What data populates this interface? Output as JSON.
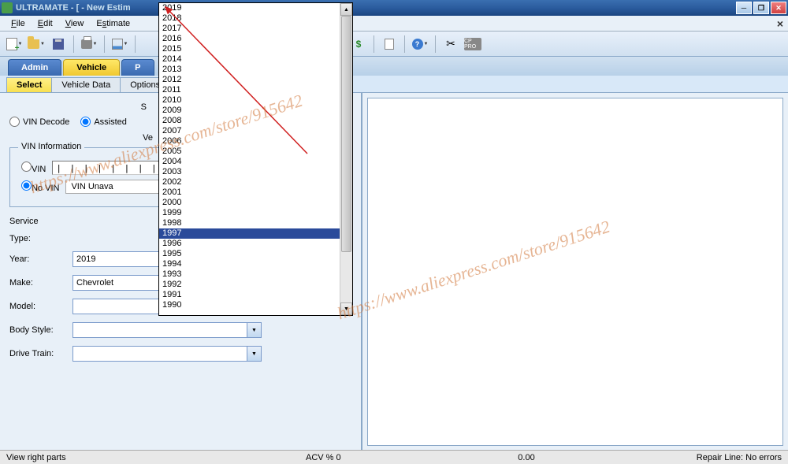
{
  "title": "ULTRAMATE - [ - New Estim",
  "menus": [
    "File",
    "Edit",
    "View",
    "Estimate"
  ],
  "menu_underline_idx": [
    0,
    0,
    0,
    1
  ],
  "main_tabs": [
    {
      "label": "Admin",
      "active": false
    },
    {
      "label": "Vehicle",
      "active": true
    },
    {
      "label": "P",
      "active": false
    }
  ],
  "sub_tabs": [
    {
      "label": "Select",
      "active": true
    },
    {
      "label": "Vehicle Data",
      "active": false
    },
    {
      "label": "Options",
      "active": false
    }
  ],
  "decode_group_label": "S",
  "decode_options": {
    "vin_decode": "VIN Decode",
    "assisted": "Assisted"
  },
  "decode_selected": "assisted",
  "vehicle_group_label": "Ve",
  "vin_info": {
    "title": "VIN Information",
    "vin_label": "VIN",
    "no_vin_label": "No VIN",
    "selected": "no_vin",
    "vin_value": "",
    "vin_slots_display": "| | | | | | | |",
    "no_vin_reason": "VIN Unava"
  },
  "form": {
    "service_label": "Service",
    "type_label": "Type:",
    "year_label": "Year:",
    "make_label": "Make:",
    "model_label": "Model:",
    "body_style_label": "Body Style:",
    "drive_train_label": "Drive Train:",
    "year_value": "2019",
    "make_value": "Chevrolet",
    "model_value": "",
    "body_style_value": "",
    "drive_train_value": ""
  },
  "year_dropdown": {
    "options": [
      "2019",
      "2018",
      "2017",
      "2016",
      "2015",
      "2014",
      "2013",
      "2012",
      "2011",
      "2010",
      "2009",
      "2008",
      "2007",
      "2006",
      "2005",
      "2004",
      "2003",
      "2002",
      "2001",
      "2000",
      "1999",
      "1998",
      "1997",
      "1996",
      "1995",
      "1994",
      "1993",
      "1992",
      "1991",
      "1990"
    ],
    "selected": "1997"
  },
  "statusbar": {
    "left": "View right parts",
    "acv": "ACV % 0",
    "mid": "0.00",
    "right": "Repair Line: No errors"
  },
  "watermark_text": "https://www.aliexpress.com/store/915642",
  "cppro_label": "CP PRO"
}
